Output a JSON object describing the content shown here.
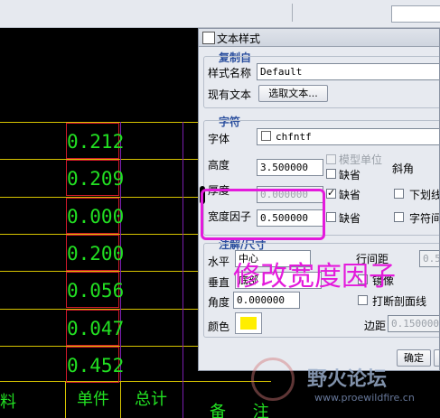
{
  "dialog": {
    "title": "文本样式",
    "copy_section": "复制自",
    "style_name_label": "样式名称",
    "style_name_value": "Default",
    "existing_text_label": "现有文本",
    "select_text_button": "选取文本...",
    "char_section": "字符",
    "font_label": "字体",
    "font_value": "chfntf",
    "height_label": "高度",
    "height_value": "3.500000",
    "model_unit_label": "模型单位",
    "default_label_1": "缺省",
    "slant_label": "斜角",
    "thickness_label": "厚度",
    "thickness_value": "0.000000",
    "default_label_2": "缺省",
    "underline_label": "下划线",
    "width_factor_label": "宽度因子",
    "width_factor_value": "0.500000",
    "default_label_3": "缺省",
    "char_spacing_label": "字符间",
    "note_section": "注解/尺寸",
    "horizontal_label": "水平",
    "horizontal_value": "中心",
    "vertical_label": "垂直",
    "vertical_value": "底部",
    "line_spacing_label": "行间距",
    "line_spacing_value": "0.5",
    "mirror_label": "镜像",
    "angle_label": "角度",
    "angle_value": "0.000000",
    "break_hatch_label": "打断剖面线",
    "color_label": "颜色",
    "color_value": "#ffee00",
    "margin_label": "边距",
    "margin_value": "0.150000",
    "ok_button": "确定"
  },
  "annotation": {
    "text": "修改宽度因子",
    "color": "#e41adc"
  },
  "table": {
    "values": [
      "0.212",
      "0.209",
      "0.000",
      "0.200",
      "0.056",
      "0.047",
      "0.452"
    ],
    "footer_left": "料",
    "footer_unit": "单件",
    "footer_total": "总计",
    "footer_remark": "备 注"
  },
  "watermark": {
    "title": "野火论坛",
    "url": "www.proewildfire.cn"
  }
}
